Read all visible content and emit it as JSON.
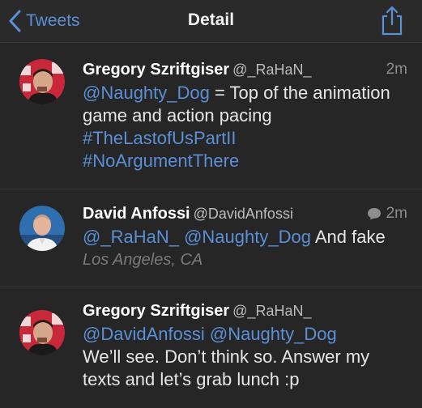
{
  "nav": {
    "back_label": "Tweets",
    "title": "Detail"
  },
  "tweets": [
    {
      "name": "Gregory Szriftgiser",
      "handle": "@_RaHaN_",
      "time": "2m",
      "mention1": "@Naughty_Dog",
      "text1": " = Top of the animation game and action pacing",
      "tag1": "#TheLastofUsPartII",
      "tag2": "#NoArgumentThere"
    },
    {
      "name": "David Anfossi",
      "handle": "@DavidAnfossi",
      "time": "2m",
      "mention1": "@_RaHaN_",
      "mention2": "@Naughty_Dog",
      "text1": " And fake",
      "location": "Los Angeles, CA"
    },
    {
      "name": "Gregory Szriftgiser",
      "handle": "@_RaHaN_",
      "mention1": "@DavidAnfossi",
      "mention2": "@Naughty_Dog",
      "text1": "We’ll see. Don’t think so. Answer my texts and let’s grab lunch :p"
    }
  ],
  "colors": {
    "background": "#262626",
    "link": "#5b8fd6",
    "divider": "#3a3a3a"
  },
  "icons": [
    "chevron-left-icon",
    "share-icon",
    "reply-bubble-icon"
  ]
}
